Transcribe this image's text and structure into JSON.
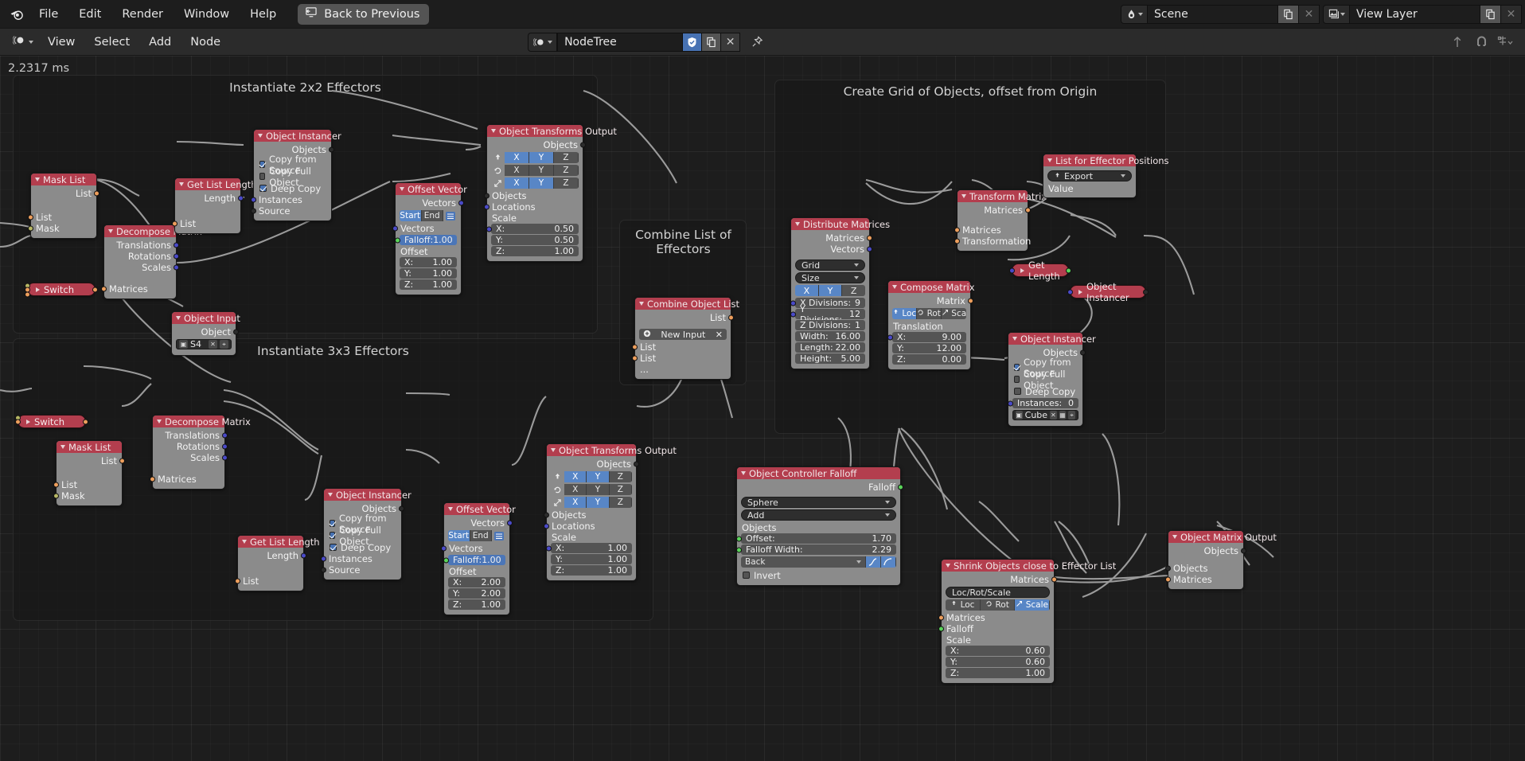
{
  "topbar": {
    "logo_icon": "blender-logo-icon",
    "menus": [
      "File",
      "Edit",
      "Render",
      "Window",
      "Help"
    ],
    "back_button": {
      "label": "Back to Previous",
      "icon": "back-arrow-icon"
    },
    "scene": {
      "value": "Scene",
      "icon": "scene-icon",
      "copy_icon": "duplicate-icon",
      "close_icon": "x-icon"
    },
    "view_layer": {
      "value": "View Layer",
      "icon": "view-layer-icon",
      "copy_icon": "duplicate-icon",
      "close_icon": "x-icon"
    }
  },
  "editor_header": {
    "editor_icon": "node-editor-icon",
    "menus": [
      "View",
      "Select",
      "Add",
      "Node"
    ],
    "nodetree": {
      "icon": "node-tree-icon",
      "value": "NodeTree",
      "check_icon": "shield-check-icon",
      "copy_icon": "duplicate-icon",
      "close_icon": "x-icon",
      "pin_icon": "pin-icon"
    },
    "right_icons": [
      "arrow-up-icon",
      "snap-magnet-icon",
      "snap-options-icon"
    ]
  },
  "canvas": {
    "timer": "2.2317 ms"
  },
  "frames": [
    {
      "label": "Instantiate 2x2 Effectors"
    },
    {
      "label": "Instantiate 3x3 Effectors"
    },
    {
      "label": "Combine List of Effectors"
    },
    {
      "label": "Create Grid of Objects, offset from Origin"
    }
  ],
  "nodes": {
    "mask_list_1": {
      "title": "Mask List",
      "outputs": [
        "List"
      ],
      "inputs": [
        "List",
        "Mask"
      ]
    },
    "switch_1": {
      "title": "Switch"
    },
    "decompose_matrix_1": {
      "title": "Decompose Matrix",
      "outputs": [
        "Translations",
        "Rotations",
        "Scales"
      ],
      "inputs": [
        "Matrices"
      ]
    },
    "get_list_length_1": {
      "title": "Get List Length",
      "outputs": [
        "Length"
      ],
      "inputs": [
        "List"
      ]
    },
    "object_instancer_1": {
      "title": "Object Instancer",
      "outputs": [
        "Objects"
      ],
      "checkboxes": [
        {
          "label": "Copy from Source",
          "checked": true
        },
        {
          "label": "Copy Full Object",
          "checked": false
        },
        {
          "label": "Deep Copy",
          "checked": true
        }
      ],
      "inputs": [
        "Instances",
        "Source"
      ]
    },
    "object_input_1": {
      "title": "Object Input",
      "outputs": [
        "Object"
      ],
      "field_value": "S4"
    },
    "offset_vector_1": {
      "title": "Offset Vector",
      "outputs": [
        "Vectors"
      ],
      "tabs": [
        "Start",
        "End"
      ],
      "active_tab": "Start",
      "inputs": [
        "Vectors"
      ],
      "falloff": {
        "label": "Falloff:",
        "value": "1.00"
      },
      "offset_label": "Offset",
      "offset": {
        "x": "1.00",
        "y": "1.00",
        "z": "1.00"
      }
    },
    "object_transforms_output_1": {
      "title": "Object Transforms Output",
      "outputs": [
        "Objects"
      ],
      "rows": [
        {
          "icon": "location-icon",
          "x": true,
          "y": true,
          "z": false
        },
        {
          "icon": "rotation-icon",
          "x": false,
          "y": false,
          "z": false
        },
        {
          "icon": "scale-icon",
          "x": true,
          "y": true,
          "z": false
        }
      ],
      "axes": [
        "X",
        "Y",
        "Z"
      ],
      "inputs": [
        "Objects",
        "Locations"
      ],
      "scale_label": "Scale",
      "scale": {
        "x": "0.50",
        "y": "0.50",
        "z": "1.00"
      }
    },
    "switch_2": {
      "title": "Switch"
    },
    "mask_list_2": {
      "title": "Mask List",
      "outputs": [
        "List"
      ],
      "inputs": [
        "List",
        "Mask"
      ]
    },
    "decompose_matrix_2": {
      "title": "Decompose Matrix",
      "outputs": [
        "Translations",
        "Rotations",
        "Scales"
      ],
      "inputs": [
        "Matrices"
      ]
    },
    "get_list_length_2": {
      "title": "Get List Length",
      "outputs": [
        "Length"
      ],
      "inputs": [
        "List"
      ]
    },
    "object_instancer_2": {
      "title": "Object Instancer",
      "outputs": [
        "Objects"
      ],
      "checkboxes": [
        {
          "label": "Copy from Source",
          "checked": true
        },
        {
          "label": "Copy Full Object",
          "checked": true
        },
        {
          "label": "Deep Copy",
          "checked": true
        }
      ],
      "inputs": [
        "Instances",
        "Source"
      ]
    },
    "offset_vector_2": {
      "title": "Offset Vector",
      "outputs": [
        "Vectors"
      ],
      "tabs": [
        "Start",
        "End"
      ],
      "active_tab": "Start",
      "inputs": [
        "Vectors"
      ],
      "falloff": {
        "label": "Falloff:",
        "value": "1.00"
      },
      "offset_label": "Offset",
      "offset": {
        "x": "2.00",
        "y": "2.00",
        "z": "1.00"
      }
    },
    "object_transforms_output_2": {
      "title": "Object Transforms Output",
      "outputs": [
        "Objects"
      ],
      "rows": [
        {
          "icon": "location-icon",
          "x": true,
          "y": true,
          "z": false
        },
        {
          "icon": "rotation-icon",
          "x": false,
          "y": false,
          "z": false
        },
        {
          "icon": "scale-icon",
          "x": true,
          "y": true,
          "z": false
        }
      ],
      "axes": [
        "X",
        "Y",
        "Z"
      ],
      "inputs": [
        "Objects",
        "Locations"
      ],
      "scale_label": "Scale",
      "scale": {
        "x": "1.00",
        "y": "1.00",
        "z": "1.00"
      }
    },
    "combine_object_list": {
      "title": "Combine Object List",
      "outputs": [
        "List"
      ],
      "new_input": {
        "label": "New Input",
        "icon": "plus-circle-icon",
        "close_icon": "x-icon"
      },
      "inputs": [
        "List",
        "List",
        "..."
      ]
    },
    "distribute_matrices": {
      "title": "Distribute Matrices",
      "outputs": [
        "Matrices",
        "Vectors"
      ],
      "dropdowns": [
        "Grid",
        "Size"
      ],
      "axes": [
        "X",
        "Y",
        "Z"
      ],
      "axes_on": [
        "X",
        "Y"
      ],
      "values": [
        {
          "label": "X Divisions:",
          "value": "9"
        },
        {
          "label": "Y Divisions:",
          "value": "12"
        },
        {
          "label": "Z Divisions:",
          "value": "1"
        },
        {
          "label": "Width:",
          "value": "16.00"
        },
        {
          "label": "Length:",
          "value": "22.00"
        },
        {
          "label": "Height:",
          "value": "5.00"
        }
      ]
    },
    "transform_matrix": {
      "title": "Transform Matrix",
      "outputs": [
        "Matrices"
      ],
      "inputs": [
        "Matrices",
        "Transformation"
      ]
    },
    "compose_matrix": {
      "title": "Compose Matrix",
      "outputs": [
        "Matrix"
      ],
      "tabs": [
        {
          "label": "Loc",
          "icon": "location-icon",
          "on": true
        },
        {
          "label": "Rot",
          "icon": "rotation-icon",
          "on": false
        },
        {
          "label": "Scale",
          "icon": "scale-icon",
          "on": false
        }
      ],
      "translation_label": "Translation",
      "translation": {
        "x": "9.00",
        "y": "12.00",
        "z": "0.00"
      }
    },
    "get_length": {
      "title": "Get Length"
    },
    "object_instancer_3_collapsed": {
      "title": "Object Instancer"
    },
    "list_for_effector_positions": {
      "title": "List for Effector Positions",
      "export": {
        "label": "Export",
        "icon": "export-icon"
      },
      "value_label": "Value"
    },
    "object_instancer_4": {
      "title": "Object Instancer",
      "outputs": [
        "Objects"
      ],
      "checkboxes": [
        {
          "label": "Copy from Source",
          "checked": true
        },
        {
          "label": "Copy Full Object",
          "checked": false
        },
        {
          "label": "Deep Copy",
          "checked": false
        }
      ],
      "instances": {
        "label": "Instances:",
        "value": "0"
      },
      "object_field": "Cube"
    },
    "object_controller_falloff": {
      "title": "Object Controller Falloff",
      "outputs": [
        "Falloff"
      ],
      "dropdowns": [
        "Sphere",
        "Add"
      ],
      "objects_label": "Objects",
      "values": [
        {
          "label": "Offset:",
          "value": "1.70"
        },
        {
          "label": "Falloff Width:",
          "value": "2.29"
        }
      ],
      "interpolation": {
        "label": "Back",
        "icon": "curve-icon"
      },
      "invert": {
        "label": "Invert",
        "checked": false
      }
    },
    "shrink_objects": {
      "title": "Shrink Objects close to Effector List",
      "outputs": [
        "Matrices"
      ],
      "mode": "Loc/Rot/Scale",
      "tabs": [
        {
          "label": "Loc",
          "on": false
        },
        {
          "label": "Rot",
          "on": false
        },
        {
          "label": "Scale",
          "on": true
        }
      ],
      "inputs": [
        "Matrices",
        "Falloff"
      ],
      "scale_label": "Scale",
      "scale": {
        "x": "0.60",
        "y": "0.60",
        "z": "1.00"
      }
    },
    "object_matrix_output": {
      "title": "Object Matrix Output",
      "outputs": [
        "Objects"
      ],
      "inputs": [
        "Objects",
        "Matrices"
      ]
    }
  }
}
